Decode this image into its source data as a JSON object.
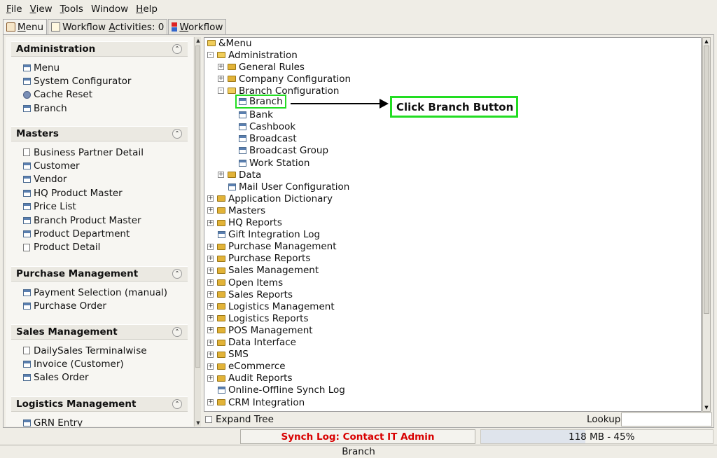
{
  "menubar": [
    {
      "pre": "",
      "u": "F",
      "post": "ile"
    },
    {
      "pre": "",
      "u": "V",
      "post": "iew"
    },
    {
      "pre": "",
      "u": "T",
      "post": "ools"
    },
    {
      "pre": "",
      "u": "",
      "post": "Window"
    },
    {
      "pre": "",
      "u": "H",
      "post": "elp"
    }
  ],
  "tabs": [
    {
      "label": "Menu",
      "u": "M",
      "rest": "enu",
      "active": true
    },
    {
      "label": "Workflow Activities: 0",
      "pre": "Workflow ",
      "u": "A",
      "rest": "ctivities: 0"
    },
    {
      "label": "Workflow",
      "u": "W",
      "rest": "orkflow"
    }
  ],
  "sidebar": {
    "sections": [
      {
        "title": "Administration",
        "items": [
          {
            "label": "Menu",
            "icon": "window-icon"
          },
          {
            "label": "System Configurator",
            "icon": "window-icon"
          },
          {
            "label": "Cache Reset",
            "icon": "gear-icon"
          },
          {
            "label": "Branch",
            "icon": "window-icon"
          }
        ]
      },
      {
        "title": "Masters",
        "items": [
          {
            "label": "Business Partner Detail",
            "icon": "document-icon"
          },
          {
            "label": "Customer",
            "icon": "window-icon"
          },
          {
            "label": "Vendor",
            "icon": "window-icon"
          },
          {
            "label": "HQ Product Master",
            "icon": "window-icon"
          },
          {
            "label": "Price List",
            "icon": "window-icon"
          },
          {
            "label": "Branch Product Master",
            "icon": "window-icon"
          },
          {
            "label": "Product Department",
            "icon": "window-icon"
          },
          {
            "label": "Product Detail",
            "icon": "document-icon"
          }
        ]
      },
      {
        "title": "Purchase Management",
        "items": [
          {
            "label": "Payment Selection (manual)",
            "icon": "window-icon"
          },
          {
            "label": "Purchase Order",
            "icon": "window-icon"
          }
        ]
      },
      {
        "title": "Sales Management",
        "items": [
          {
            "label": "DailySales Terminalwise",
            "icon": "document-icon"
          },
          {
            "label": "Invoice (Customer)",
            "icon": "window-icon"
          },
          {
            "label": "Sales Order",
            "icon": "window-icon"
          }
        ]
      },
      {
        "title": "Logistics Management",
        "items": [
          {
            "label": "GRN Entry",
            "icon": "window-icon"
          }
        ]
      }
    ]
  },
  "tree": {
    "root": "&Menu",
    "rows": [
      {
        "label": "Administration",
        "type": "folder-open",
        "exp": "-",
        "level": 1
      },
      {
        "label": "General Rules",
        "type": "folder",
        "exp": "+",
        "level": 2
      },
      {
        "label": "Company Configuration",
        "type": "folder",
        "exp": "+",
        "level": 2
      },
      {
        "label": "Branch Configuration",
        "type": "folder-open",
        "exp": "-",
        "level": 2
      },
      {
        "label": "Branch",
        "type": "window",
        "level": 3,
        "highlight": true
      },
      {
        "label": "Bank",
        "type": "window",
        "level": 3
      },
      {
        "label": "Cashbook",
        "type": "window",
        "level": 3
      },
      {
        "label": "Broadcast",
        "type": "window",
        "level": 3
      },
      {
        "label": "Broadcast Group",
        "type": "window",
        "level": 3
      },
      {
        "label": "Work Station",
        "type": "window",
        "level": 3
      },
      {
        "label": "Data",
        "type": "folder",
        "exp": "+",
        "level": 2
      },
      {
        "label": "Mail User Configuration",
        "type": "window",
        "level": 2
      },
      {
        "label": "Application Dictionary",
        "type": "folder",
        "exp": "+",
        "level": 1
      },
      {
        "label": "Masters",
        "type": "folder",
        "exp": "+",
        "level": 1
      },
      {
        "label": "HQ Reports",
        "type": "folder",
        "exp": "+",
        "level": 1
      },
      {
        "label": "Gift Integration Log",
        "type": "window",
        "level": 1
      },
      {
        "label": "Purchase Management",
        "type": "folder",
        "exp": "+",
        "level": 1
      },
      {
        "label": "Purchase Reports",
        "type": "folder",
        "exp": "+",
        "level": 1
      },
      {
        "label": "Sales Management",
        "type": "folder",
        "exp": "+",
        "level": 1
      },
      {
        "label": "Open Items",
        "type": "folder",
        "exp": "+",
        "level": 1
      },
      {
        "label": "Sales Reports",
        "type": "folder",
        "exp": "+",
        "level": 1
      },
      {
        "label": "Logistics Management",
        "type": "folder",
        "exp": "+",
        "level": 1
      },
      {
        "label": "Logistics Reports",
        "type": "folder",
        "exp": "+",
        "level": 1
      },
      {
        "label": "POS Management",
        "type": "folder",
        "exp": "+",
        "level": 1
      },
      {
        "label": "Data Interface",
        "type": "folder",
        "exp": "+",
        "level": 1
      },
      {
        "label": "SMS",
        "type": "folder",
        "exp": "+",
        "level": 1
      },
      {
        "label": "eCommerce",
        "type": "folder",
        "exp": "+",
        "level": 1
      },
      {
        "label": "Audit Reports",
        "type": "folder",
        "exp": "+",
        "level": 1
      },
      {
        "label": "Online-Offline Synch Log",
        "type": "window",
        "level": 1
      },
      {
        "label": "CRM Integration",
        "type": "folder",
        "exp": "+",
        "level": 1
      }
    ]
  },
  "annotation": {
    "callout": "Click Branch Button"
  },
  "bottom": {
    "expand_tree": "Expand Tree",
    "lookup": "Lookup",
    "lookup_value": ""
  },
  "status": {
    "sync": "Synch Log: Contact IT Admin",
    "memory": "118 MB - 45%",
    "memory_percent": 45,
    "footer": "Branch"
  },
  "colors": {
    "highlight": "#22dd22",
    "sync_text": "#d80000",
    "accent": "#4a6a90"
  }
}
